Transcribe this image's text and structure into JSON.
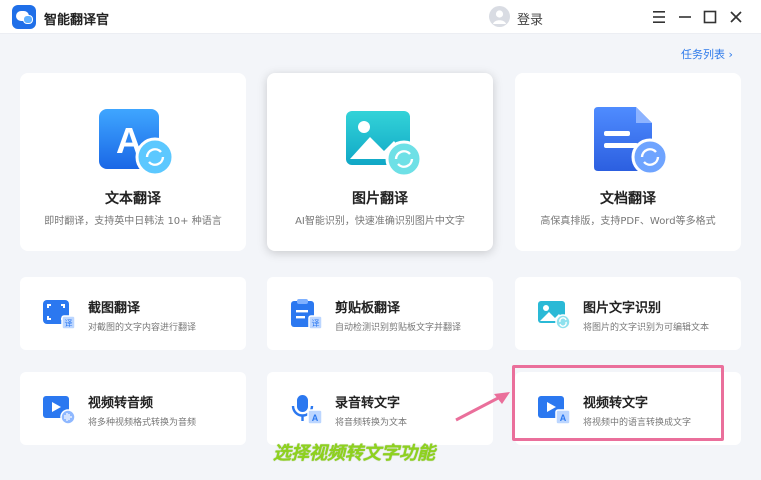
{
  "app": {
    "title": "智能翻译官",
    "login_label": "登录",
    "task_list_label": "任务列表 ›"
  },
  "big_cards": [
    {
      "title": "文本翻译",
      "desc": "即时翻译，支持英中日韩法 10+ 种语言",
      "icon": "text-translate-icon"
    },
    {
      "title": "图片翻译",
      "desc": "AI智能识别，快速准确识别图片中文字",
      "icon": "image-translate-icon"
    },
    {
      "title": "文档翻译",
      "desc": "高保真排版，支持PDF、Word等多格式",
      "icon": "document-translate-icon"
    }
  ],
  "small_cards": [
    {
      "title": "截图翻译",
      "desc": "对截图的文字内容进行翻译",
      "icon": "screenshot-translate-icon"
    },
    {
      "title": "剪贴板翻译",
      "desc": "自动检测识别剪贴板文字并翻译",
      "icon": "clipboard-translate-icon"
    },
    {
      "title": "图片文字识别",
      "desc": "将图片的文字识别为可编辑文本",
      "icon": "image-ocr-icon"
    },
    {
      "title": "视频转音频",
      "desc": "将多种视频格式转换为音频",
      "icon": "video-to-audio-icon"
    },
    {
      "title": "录音转文字",
      "desc": "将音频转换为文本",
      "icon": "audio-to-text-icon"
    },
    {
      "title": "视频转文字",
      "desc": "将视频中的语言转换成文字",
      "icon": "video-to-text-icon"
    }
  ],
  "annotation": {
    "text": "选择视频转文字功能"
  },
  "colors": {
    "accent": "#1f6fe8",
    "link": "#2f7bea",
    "highlight": "#ea6f9b",
    "annotation": "#8ed21e"
  }
}
